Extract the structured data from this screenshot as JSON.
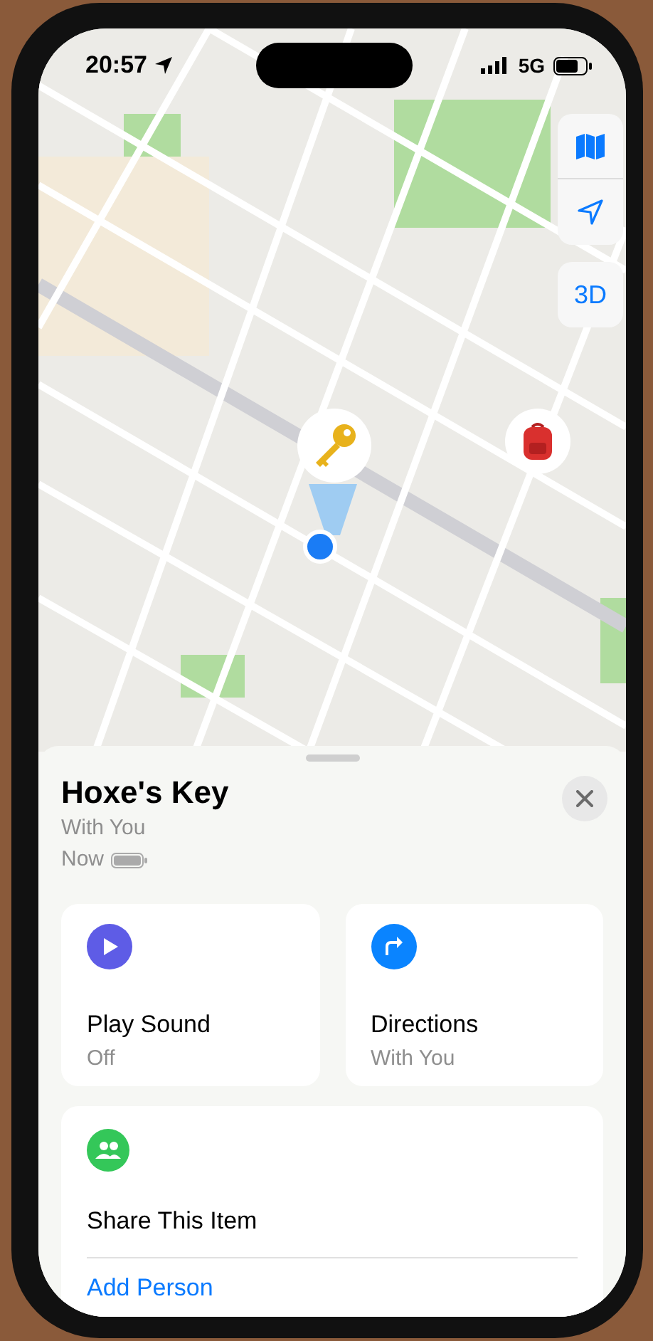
{
  "status_bar": {
    "time": "20:57",
    "network": "5G"
  },
  "map_controls": {
    "view_mode": "3D"
  },
  "item": {
    "title": "Hoxe's Key",
    "status": "With You",
    "updated": "Now"
  },
  "actions": [
    {
      "kind": "play",
      "title": "Play Sound",
      "subtitle": "Off",
      "color": "#5e5ce6"
    },
    {
      "kind": "directions",
      "title": "Directions",
      "subtitle": "With You",
      "color": "#0a84ff"
    }
  ],
  "share": {
    "title": "Share This Item",
    "link": "Add Person",
    "color": "#34c759"
  }
}
